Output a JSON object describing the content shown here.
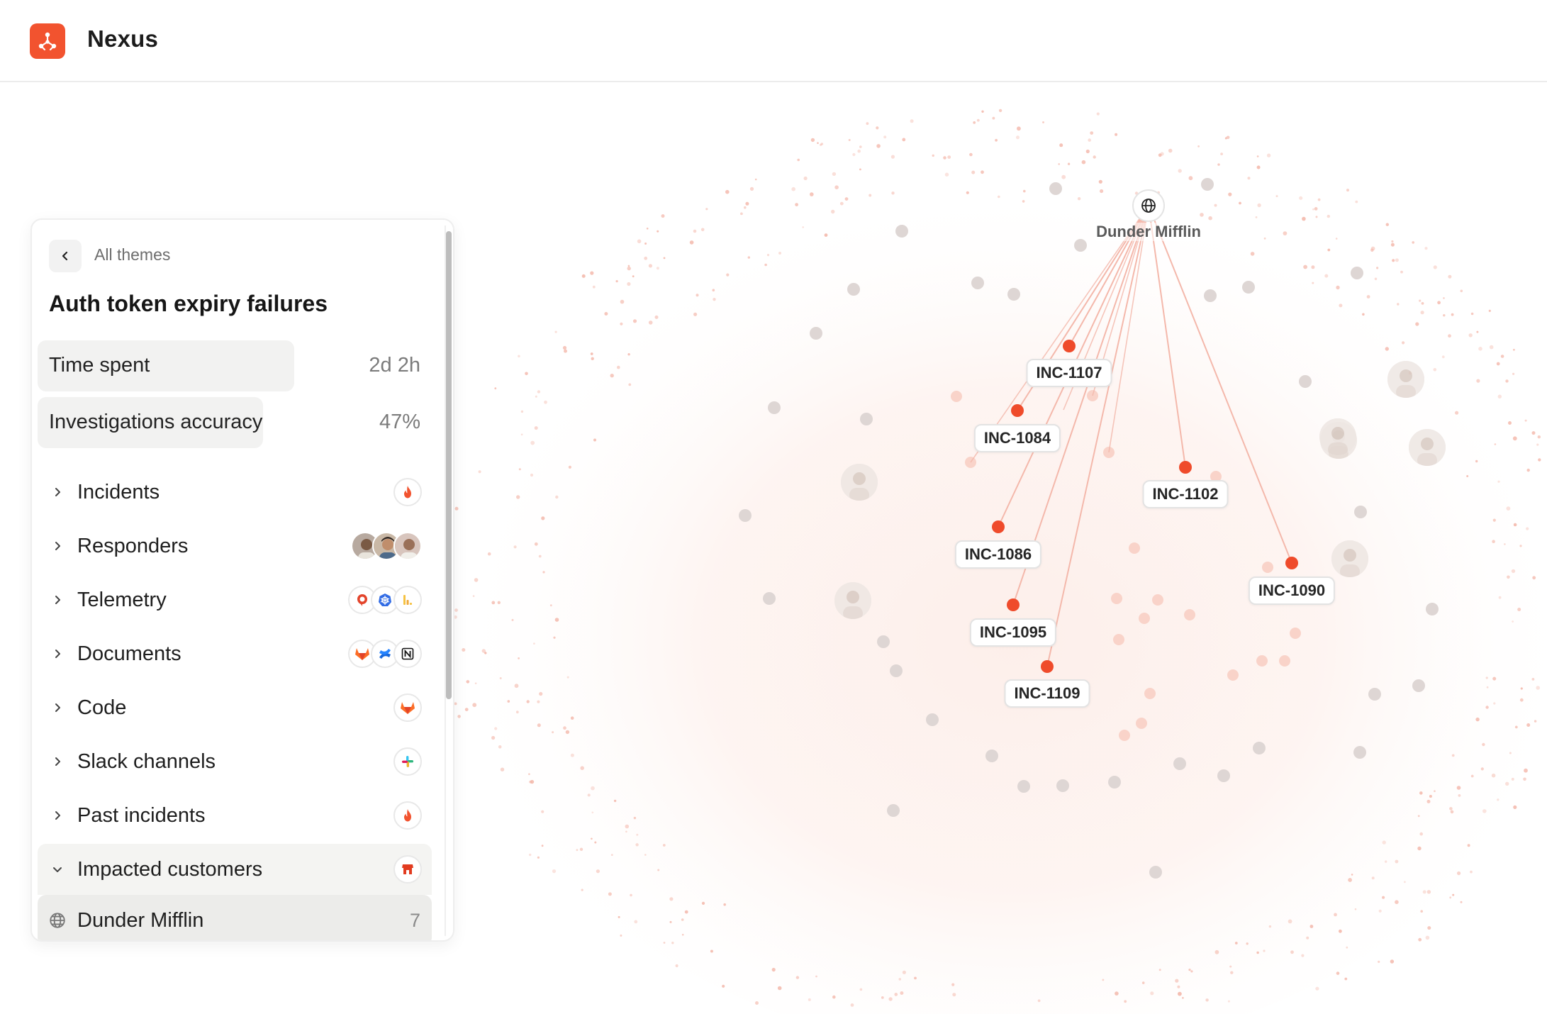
{
  "app": {
    "title": "Nexus",
    "logo_icon": "nexus-logo-icon",
    "brand_color": "#f2532f"
  },
  "panel": {
    "back_label": "All themes",
    "theme_title": "Auth token expiry failures",
    "metrics": [
      {
        "label": "Time spent",
        "value": "2d 2h",
        "fraction": 0.47
      },
      {
        "label": "Investigations accuracy",
        "value": "47%",
        "fraction": 0.41
      }
    ],
    "sections": [
      {
        "label": "Incidents",
        "icons": [
          "incident-fire-icon"
        ]
      },
      {
        "label": "Responders",
        "icons": [
          "responder-avatar-1",
          "responder-avatar-2",
          "responder-avatar-3"
        ]
      },
      {
        "label": "Telemetry",
        "icons": [
          "grafana-icon",
          "kubernetes-icon",
          "logs-icon"
        ]
      },
      {
        "label": "Documents",
        "icons": [
          "gitlab-icon",
          "confluence-icon",
          "notion-icon"
        ]
      },
      {
        "label": "Code",
        "icons": [
          "gitlab-icon"
        ]
      },
      {
        "label": "Slack channels",
        "icons": [
          "slack-icon"
        ]
      },
      {
        "label": "Past incidents",
        "icons": [
          "incident-fire-icon"
        ]
      },
      {
        "label": "Impacted customers",
        "icons": [
          "store-icon"
        ],
        "expanded": true
      }
    ],
    "selected_customer": {
      "label": "Dunder Mifflin",
      "count": "7",
      "icon": "globe-icon"
    }
  },
  "graph": {
    "hub": {
      "label": "Dunder Mifflin",
      "icon": "globe-icon"
    },
    "incidents": [
      "INC-1107",
      "INC-1084",
      "INC-1102",
      "INC-1086",
      "INC-1090",
      "INC-1095",
      "INC-1109"
    ],
    "accent_color": "#ef4b2b",
    "edge_color": "#f4b8ab",
    "node_color": "#ded6d4"
  }
}
